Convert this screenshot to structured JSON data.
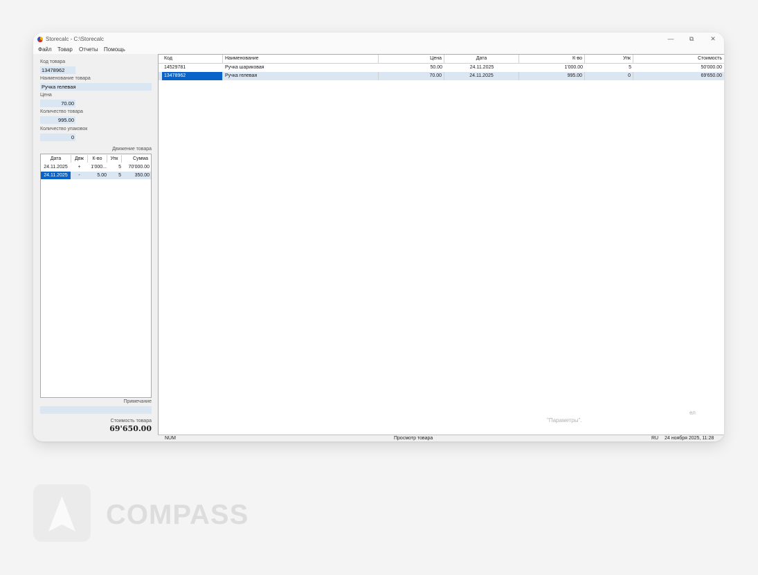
{
  "window": {
    "title": "Storecalc - C:\\Storecalc",
    "controls": {
      "minimize": "—",
      "restore": "⧉",
      "close": "✕"
    }
  },
  "menu": [
    "Файл",
    "Товар",
    "Отчеты",
    "Помощь"
  ],
  "form": {
    "code": {
      "label": "Код товара",
      "value": "13478962"
    },
    "name": {
      "label": "Наименование товара",
      "value": "Ручка гелевая"
    },
    "price": {
      "label": "Цена",
      "value": "70.00"
    },
    "qty": {
      "label": "Количество товара",
      "value": "995.00"
    },
    "packs": {
      "label": "Количество упаковок",
      "value": "0"
    },
    "movement_label": "Движение товара",
    "note_label": "Примечание",
    "note_value": "",
    "total_label": "Стоимость товара",
    "total_value": "69'650.00"
  },
  "movement": {
    "columns": [
      "Дата",
      "Двж",
      "К-во",
      "Упк",
      "Сумма"
    ],
    "rows": [
      [
        "24.11.2025",
        "+",
        "1'000...",
        "5",
        "70'000.00"
      ],
      [
        "24.11.2025",
        "-",
        "5.00",
        "5",
        "350.00"
      ]
    ]
  },
  "grid": {
    "columns": [
      "Код",
      "Наименование",
      "Цена",
      "Дата",
      "К-во",
      "Упк",
      "Стоимость"
    ],
    "rows": [
      [
        "14529781",
        "Ручка шариковая",
        "50.00",
        "24.11.2025",
        "1'000.00",
        "5",
        "50'000.00"
      ],
      [
        "13478962",
        "Ручка гелевая",
        "70.00",
        "24.11.2025",
        "995.00",
        "0",
        "69'650.00"
      ]
    ],
    "ghost_text": "\"Параметры\".",
    "ghost_text2": "ел"
  },
  "status": {
    "num": "NUM",
    "mode": "Просмотр товара",
    "lang": "RU",
    "datetime": "24 ноября 2025, 11:28"
  },
  "brand": {
    "name": "COMPASS"
  },
  "colors": {
    "selection": "#0a63c8",
    "field": "#dbe6f3"
  }
}
